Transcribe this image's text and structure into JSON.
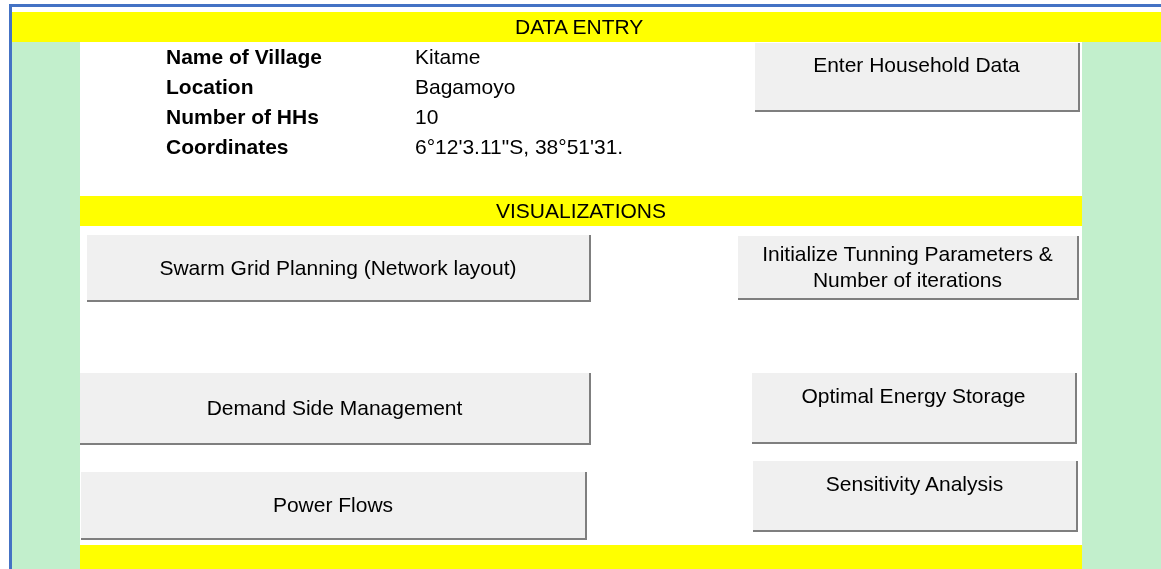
{
  "data_entry": {
    "title": "DATA ENTRY",
    "fields": [
      {
        "label": "Name of Village",
        "value": "Kitame"
      },
      {
        "label": "Location",
        "value": "Bagamoyo"
      },
      {
        "label": "Number of HHs",
        "value": "10"
      },
      {
        "label": "Coordinates",
        "value": "6°12'3.11\"S, 38°51'31."
      }
    ],
    "button": "Enter Household Data"
  },
  "visualizations": {
    "title": "VISUALIZATIONS",
    "left_buttons": [
      "Swarm Grid Planning (Network layout)",
      "Demand Side Management",
      "Power Flows"
    ],
    "right_buttons": [
      "Initialize Tunning Parameters & Number of iterations",
      "Optimal Energy Storage",
      "Sensitivity Analysis"
    ]
  }
}
